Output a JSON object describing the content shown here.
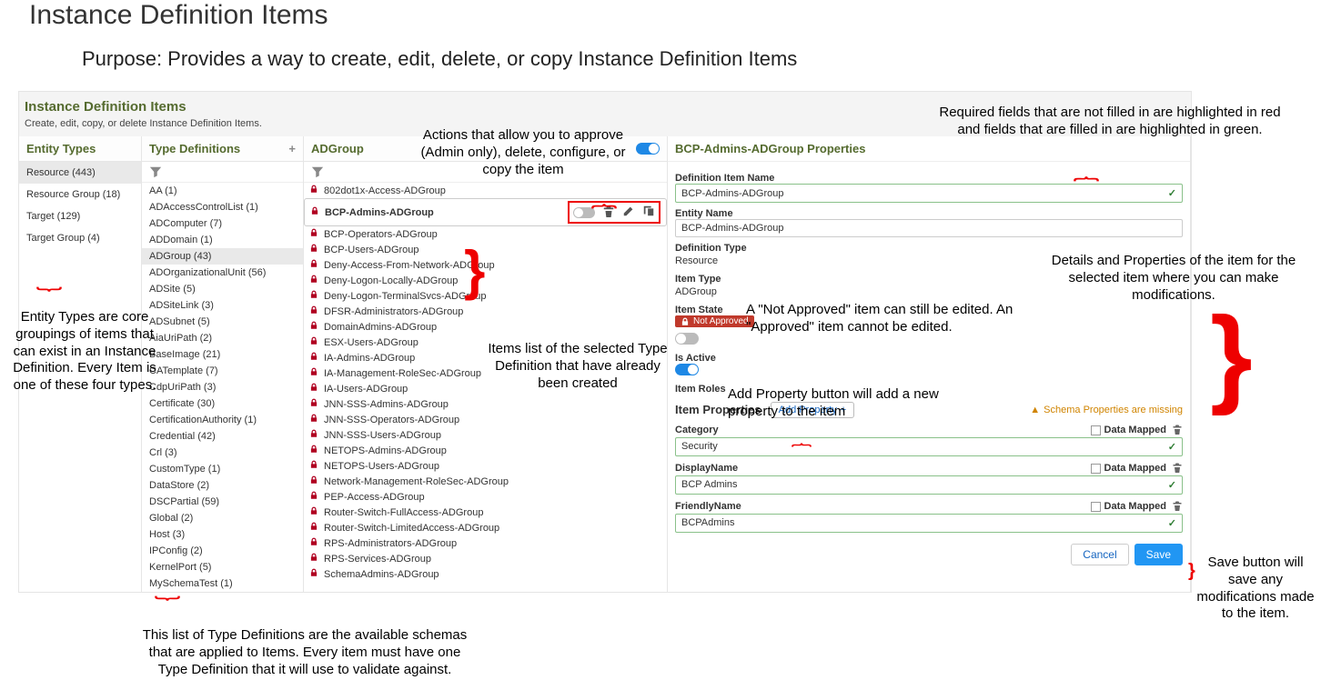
{
  "slide": {
    "title": "Instance Definition Items",
    "purpose": "Purpose: Provides a way to create, edit, delete, or copy Instance Definition Items"
  },
  "app": {
    "title": "Instance Definition Items",
    "subtitle": "Create, edit, copy, or delete Instance Definition Items."
  },
  "entityTypes": {
    "header": "Entity Types",
    "items": [
      {
        "label": "Resource (443)",
        "selected": true
      },
      {
        "label": "Resource Group (18)"
      },
      {
        "label": "Target (129)"
      },
      {
        "label": "Target Group (4)"
      }
    ]
  },
  "typeDefs": {
    "header": "Type Definitions",
    "items": [
      "AA (1)",
      "ADAccessControlList (1)",
      "ADComputer (7)",
      "ADDomain (1)",
      "ADGroup (43)",
      "ADOrganizationalUnit (56)",
      "ADSite (5)",
      "ADSiteLink (3)",
      "ADSubnet (5)",
      "AiaUriPath (2)",
      "BaseImage (21)",
      "CATemplate (7)",
      "CdpUriPath (3)",
      "Certificate (30)",
      "CertificationAuthority (1)",
      "Credential (42)",
      "Crl (3)",
      "CustomType (1)",
      "DataStore (2)",
      "DSCPartial (59)",
      "Global (2)",
      "Host (3)",
      "IPConfig (2)",
      "KernelPort (5)",
      "MySchemaTest (1)"
    ],
    "selectedIndex": 4
  },
  "itemsPanel": {
    "header": "ADGroup",
    "items": [
      "802dot1x-Access-ADGroup",
      "BCP-Admins-ADGroup",
      "BCP-Operators-ADGroup",
      "BCP-Users-ADGroup",
      "Deny-Access-From-Network-ADGroup",
      "Deny-Logon-Locally-ADGroup",
      "Deny-Logon-TerminalSvcs-ADGroup",
      "DFSR-Administrators-ADGroup",
      "DomainAdmins-ADGroup",
      "ESX-Users-ADGroup",
      "IA-Admins-ADGroup",
      "IA-Management-RoleSec-ADGroup",
      "IA-Users-ADGroup",
      "JNN-SSS-Admins-ADGroup",
      "JNN-SSS-Operators-ADGroup",
      "JNN-SSS-Users-ADGroup",
      "NETOPS-Admins-ADGroup",
      "NETOPS-Users-ADGroup",
      "Network-Management-RoleSec-ADGroup",
      "PEP-Access-ADGroup",
      "Router-Switch-FullAccess-ADGroup",
      "Router-Switch-LimitedAccess-ADGroup",
      "RPS-Administrators-ADGroup",
      "RPS-Services-ADGroup",
      "SchemaAdmins-ADGroup"
    ],
    "selectedIndex": 1
  },
  "properties": {
    "header": "BCP-Admins-ADGroup Properties",
    "definitionItemName": {
      "label": "Definition Item Name",
      "value": "BCP-Admins-ADGroup"
    },
    "entityName": {
      "label": "Entity Name",
      "value": "BCP-Admins-ADGroup"
    },
    "definitionType": {
      "label": "Definition Type",
      "value": "Resource"
    },
    "itemType": {
      "label": "Item Type",
      "value": "ADGroup"
    },
    "itemState": {
      "label": "Item State",
      "badge": "Not Approved"
    },
    "isActive": {
      "label": "Is Active"
    },
    "itemRoles": {
      "label": "Item Roles"
    },
    "itemPropertiesTitle": "Item Properties",
    "addProperty": "Add Property",
    "schemaWarning": "Schema Properties are missing",
    "props": [
      {
        "name": "Category",
        "value": "Security",
        "dataMapped": "Data Mapped"
      },
      {
        "name": "DisplayName",
        "value": "BCP Admins",
        "dataMapped": "Data Mapped"
      },
      {
        "name": "FriendlyName",
        "value": "BCPAdmins",
        "dataMapped": "Data Mapped"
      }
    ],
    "cancel": "Cancel",
    "save": "Save"
  },
  "annotations": {
    "actions": "Actions that allow you to approve (Admin only), delete, configure, or copy the item",
    "entityTypes": "Entity Types are core groupings of items that can exist in an Instance Definition. Every Item is one of these four types.",
    "typeDefs": "This list of Type Definitions are the available schemas that are applied to Items. Every item must have one Type Definition that it will use to validate against.",
    "itemsList": "Items list of the selected Type Definition that have already been created",
    "requiredFields": "Required fields that are not filled in are highlighted in red and fields that are filled in are highlighted in green.",
    "notApproved": "A \"Not Approved\" item can still be edited. An \"Approved\" item cannot be edited.",
    "addProp": "Add Property button will add a new property to the item",
    "detailsProps": "Details and Properties of the item for the selected item where you can make modifications.",
    "saveBtn": "Save button will save any modifications made to the item."
  }
}
